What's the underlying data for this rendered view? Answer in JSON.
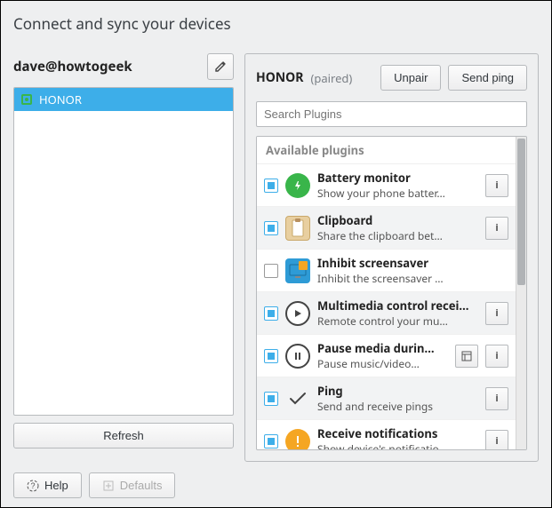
{
  "title": "Connect and sync your devices",
  "username": "dave@howtogeek",
  "edit_tooltip": "Edit",
  "sidebar": {
    "devices": [
      {
        "name": "HONOR",
        "online": true
      }
    ],
    "refresh_label": "Refresh"
  },
  "main": {
    "device_name": "HONOR",
    "device_status": "(paired)",
    "unpair_label": "Unpair",
    "sendping_label": "Send ping",
    "search_placeholder": "Search Plugins",
    "plugins_header": "Available plugins",
    "plugins": [
      {
        "title": "Battery monitor",
        "desc": "Show your phone batter…",
        "checked": true,
        "icon": "battery",
        "buttons": [
          "info"
        ]
      },
      {
        "title": "Clipboard",
        "desc": "Share the clipboard bet…",
        "checked": true,
        "icon": "clipboard",
        "buttons": [
          "info"
        ]
      },
      {
        "title": "Inhibit screensaver",
        "desc": "Inhibit the screensaver …",
        "checked": false,
        "icon": "screensaver",
        "buttons": []
      },
      {
        "title": "Multimedia control recei…",
        "desc": "Remote control your mu…",
        "checked": true,
        "icon": "media",
        "buttons": [
          "info"
        ]
      },
      {
        "title": "Pause media durin…",
        "desc": "Pause music/video…",
        "checked": true,
        "icon": "pause",
        "buttons": [
          "config",
          "info"
        ]
      },
      {
        "title": "Ping",
        "desc": "Send and receive pings",
        "checked": true,
        "icon": "ping",
        "buttons": [
          "info"
        ]
      },
      {
        "title": "Receive notifications",
        "desc": "Show device's notificatio…",
        "checked": true,
        "icon": "notif",
        "buttons": [
          "info"
        ]
      }
    ]
  },
  "footer": {
    "help_label": "Help",
    "defaults_label": "Defaults"
  }
}
